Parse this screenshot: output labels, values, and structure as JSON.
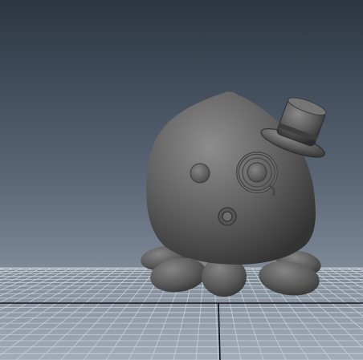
{
  "viewport": {
    "panel": "perspective-3d-viewport",
    "background": {
      "top": "#2f3946",
      "bottom": "#9aa5b2"
    },
    "grid": {
      "color": "#c9cfd6",
      "axis_color": "#141414"
    }
  },
  "model": {
    "name": "octopus-with-top-hat-and-monocle",
    "shading": "smooth-gray",
    "base_color": "#5e5e5e",
    "highlight_color": "#8f8f8f",
    "shadow_color": "#2b2b2b"
  }
}
